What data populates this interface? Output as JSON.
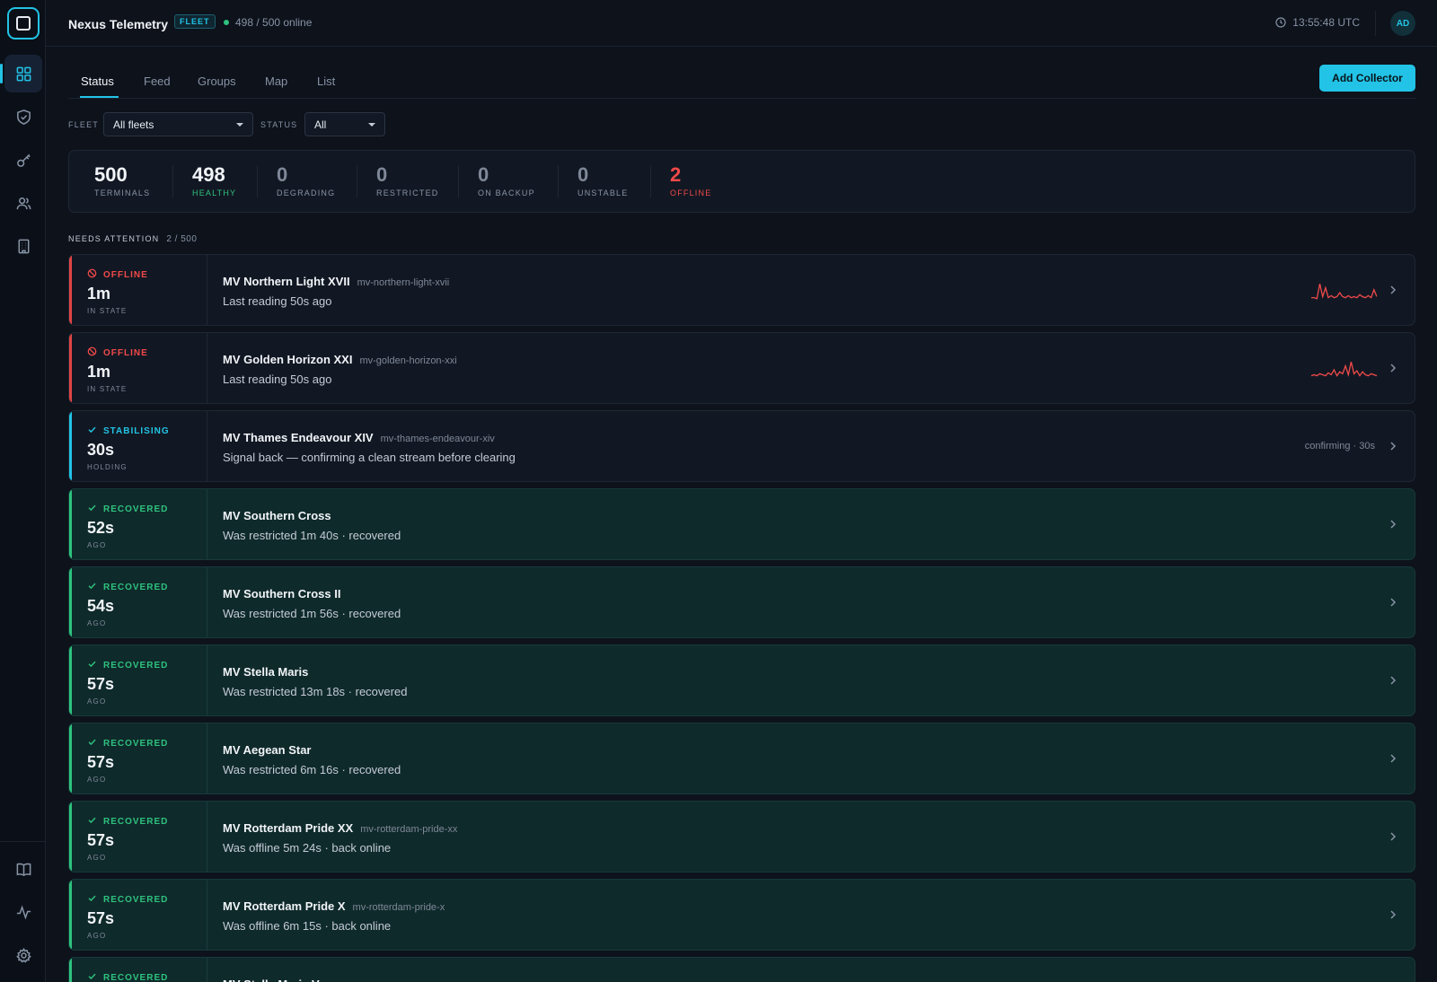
{
  "app": {
    "title": "Nexus Telemetry",
    "tag": "FLEET",
    "online": "498 / 500 online",
    "clock": "13:55:48 UTC",
    "avatar": "AD"
  },
  "sidebar": {
    "items": [
      {
        "icon": "dashboard-grid-icon",
        "active": true
      },
      {
        "icon": "shield-check-icon"
      },
      {
        "icon": "key-icon"
      },
      {
        "icon": "users-icon"
      },
      {
        "icon": "building-icon"
      }
    ],
    "footer_items": [
      {
        "icon": "book-icon"
      },
      {
        "icon": "activity-pulse-icon"
      },
      {
        "icon": "gear-icon"
      }
    ]
  },
  "tabs": [
    "Status",
    "Feed",
    "Groups",
    "Map",
    "List"
  ],
  "actions": {
    "add_collector": "Add Collector"
  },
  "filters": {
    "fleet": {
      "label": "FLEET",
      "value": "All fleets"
    },
    "status": {
      "label": "STATUS",
      "value": "All"
    }
  },
  "stats": [
    {
      "value": "500",
      "label": "TERMINALS"
    },
    {
      "value": "498",
      "label": "HEALTHY"
    },
    {
      "value": "0",
      "label": "DEGRADING"
    },
    {
      "value": "0",
      "label": "RESTRICTED"
    },
    {
      "value": "0",
      "label": "ON BACKUP"
    },
    {
      "value": "0",
      "label": "UNSTABLE"
    },
    {
      "value": "2",
      "label": "OFFLINE"
    }
  ],
  "attention": {
    "label": "NEEDS ATTENTION",
    "count": "2 / 500"
  },
  "rows": [
    {
      "status": "OFFLINE",
      "kind": "offline",
      "duration": "1m",
      "duration_label": "IN STATE",
      "name": "MV Northern Light XVII",
      "id": "mv-northern-light-xvii",
      "detail": "Last reading 50s ago",
      "spark": [
        4,
        4,
        3,
        18,
        5,
        14,
        4,
        6,
        4,
        5,
        9,
        5,
        4,
        6,
        4,
        5,
        4,
        7,
        5,
        4,
        6,
        4,
        12,
        5
      ],
      "extra": ""
    },
    {
      "status": "OFFLINE",
      "kind": "offline",
      "duration": "1m",
      "duration_label": "IN STATE",
      "name": "MV Golden Horizon XXI",
      "id": "mv-golden-horizon-xxi",
      "detail": "Last reading 50s ago",
      "spark": [
        4,
        5,
        4,
        6,
        5,
        4,
        7,
        5,
        10,
        4,
        8,
        6,
        14,
        5,
        18,
        6,
        9,
        4,
        8,
        5,
        4,
        6,
        5,
        4
      ],
      "extra": ""
    },
    {
      "status": "STABILISING",
      "kind": "stabilising",
      "duration": "30s",
      "duration_label": "HOLDING",
      "name": "MV Thames Endeavour XIV",
      "id": "mv-thames-endeavour-xiv",
      "detail": "Signal back — confirming a clean stream before clearing",
      "spark": null,
      "extra": "confirming · 30s"
    },
    {
      "status": "RECOVERED",
      "kind": "recovered",
      "duration": "52s",
      "duration_label": "AGO",
      "name": "MV Southern Cross",
      "id": "",
      "detail": "Was restricted 1m 40s · recovered",
      "spark": null,
      "extra": ""
    },
    {
      "status": "RECOVERED",
      "kind": "recovered",
      "duration": "54s",
      "duration_label": "AGO",
      "name": "MV Southern Cross II",
      "id": "",
      "detail": "Was restricted 1m 56s · recovered",
      "spark": null,
      "extra": ""
    },
    {
      "status": "RECOVERED",
      "kind": "recovered",
      "duration": "57s",
      "duration_label": "AGO",
      "name": "MV Stella Maris",
      "id": "",
      "detail": "Was restricted 13m 18s · recovered",
      "spark": null,
      "extra": ""
    },
    {
      "status": "RECOVERED",
      "kind": "recovered",
      "duration": "57s",
      "duration_label": "AGO",
      "name": "MV Aegean Star",
      "id": "",
      "detail": "Was restricted 6m 16s · recovered",
      "spark": null,
      "extra": ""
    },
    {
      "status": "RECOVERED",
      "kind": "recovered",
      "duration": "57s",
      "duration_label": "AGO",
      "name": "MV Rotterdam Pride XX",
      "id": "mv-rotterdam-pride-xx",
      "detail": "Was offline 5m 24s · back online",
      "spark": null,
      "extra": ""
    },
    {
      "status": "RECOVERED",
      "kind": "recovered",
      "duration": "57s",
      "duration_label": "AGO",
      "name": "MV Rotterdam Pride X",
      "id": "mv-rotterdam-pride-x",
      "detail": "Was offline 6m 15s · back online",
      "spark": null,
      "extra": ""
    },
    {
      "status": "RECOVERED",
      "kind": "recovered",
      "duration": "",
      "duration_label": "",
      "name": "MV Stella Maris V",
      "id": "",
      "detail": "",
      "spark": null,
      "extra": ""
    }
  ],
  "colors": {
    "accent": "#22c3e6",
    "offline": "#f04a4a",
    "healthy": "#2ec27e",
    "background": "#0d121b"
  }
}
